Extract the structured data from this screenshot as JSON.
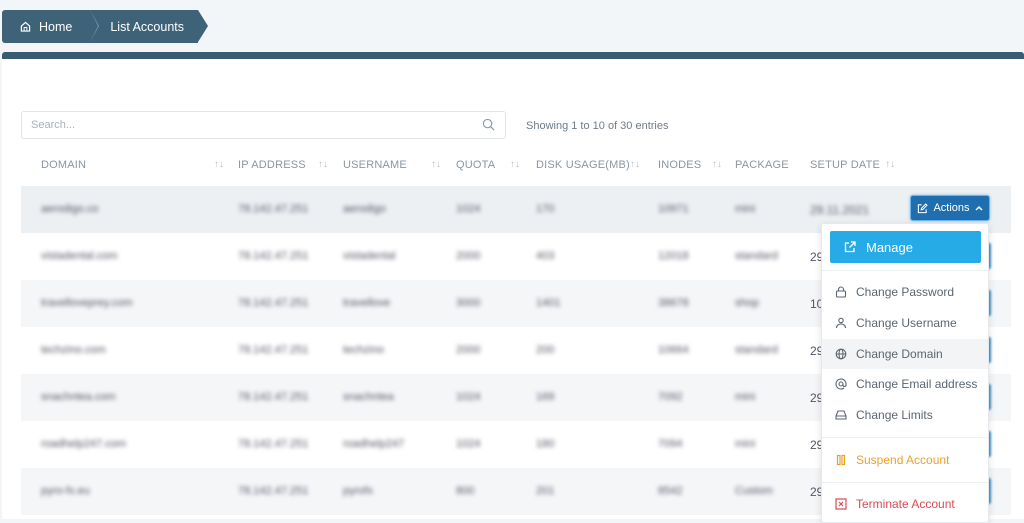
{
  "breadcrumb": {
    "home": "Home",
    "current": "List Accounts"
  },
  "search": {
    "placeholder": "Search...",
    "value": ""
  },
  "info": "Showing 1 to 10 of 30 entries",
  "columns": [
    "DOMAIN",
    "IP ADDRESS",
    "USERNAME",
    "QUOTA",
    "DISK USAGE(MB)",
    "INODES",
    "PACKAGE",
    "SETUP DATE"
  ],
  "rows": [
    {
      "domain": "aerodigo.co",
      "ip": "78.142.47.251",
      "username": "aerodigo",
      "quota": "1024",
      "disk": "170",
      "inodes": "10971",
      "package": "mini",
      "date": "29.11.2021"
    },
    {
      "domain": "vistadental.com",
      "ip": "78.142.47.251",
      "username": "vistadental",
      "quota": "2000",
      "disk": "403",
      "inodes": "12018",
      "package": "standard",
      "date": "29"
    },
    {
      "domain": "travelloveprey.com",
      "ip": "78.142.47.251",
      "username": "travellove",
      "quota": "3000",
      "disk": "1401",
      "inodes": "38678",
      "package": "shop",
      "date": "10"
    },
    {
      "domain": "techzino.com",
      "ip": "78.142.47.251",
      "username": "techzino",
      "quota": "2000",
      "disk": "200",
      "inodes": "10664",
      "package": "standard",
      "date": "29"
    },
    {
      "domain": "snachntea.com",
      "ip": "78.142.47.251",
      "username": "snachntea",
      "quota": "1024",
      "disk": "169",
      "inodes": "7092",
      "package": "mini",
      "date": "29"
    },
    {
      "domain": "roadhelp247.com",
      "ip": "78.142.47.251",
      "username": "roadhelp247",
      "quota": "1024",
      "disk": "180",
      "inodes": "7094",
      "package": "mini",
      "date": "29"
    },
    {
      "domain": "pyro-fx.eu",
      "ip": "78.142.47.251",
      "username": "pyrofx",
      "quota": "800",
      "disk": "201",
      "inodes": "8542",
      "package": "Custom",
      "date": "29"
    }
  ],
  "actions_label": "Actions",
  "menu": {
    "manage": "Manage",
    "items": [
      "Change Password",
      "Change Username",
      "Change Domain",
      "Change Email address",
      "Change Limits"
    ],
    "suspend": "Suspend Account",
    "terminate": "Terminate Account"
  },
  "colors": {
    "header": "#3e6278",
    "manage": "#27abe7",
    "actions": "#1f6fb0",
    "suspend": "#eaa030",
    "terminate": "#d64b55"
  }
}
